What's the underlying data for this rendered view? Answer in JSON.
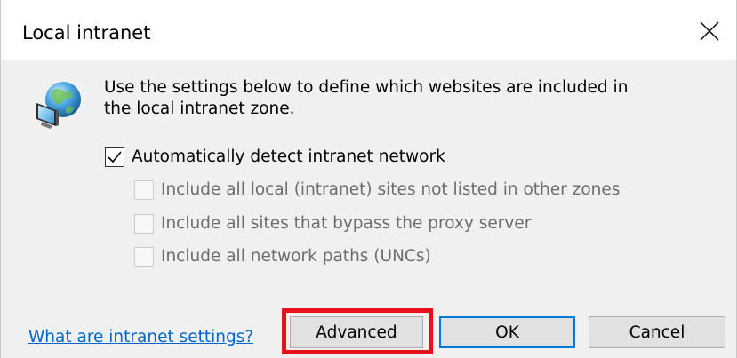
{
  "window": {
    "title": "Local intranet",
    "close_icon": "close-icon"
  },
  "intro": {
    "icon": "globe-monitor-icon",
    "line1": "Use the settings below to define which websites are included in",
    "line2": "the local intranet zone."
  },
  "options": {
    "auto_detect": {
      "label": "Automatically detect intranet network",
      "checked": true,
      "enabled": true
    },
    "include_local_sites": {
      "label": "Include all local (intranet) sites not listed in other zones",
      "checked": false,
      "enabled": false
    },
    "include_bypass_proxy": {
      "label": "Include all sites that bypass the proxy server",
      "checked": false,
      "enabled": false
    },
    "include_network_paths": {
      "label": "Include all network paths (UNCs)",
      "checked": false,
      "enabled": false
    }
  },
  "footer": {
    "help_link": "What are intranet settings?",
    "advanced_label": "Advanced",
    "ok_label": "OK",
    "cancel_label": "Cancel"
  },
  "colors": {
    "dialog_bg": "#f0f0f0",
    "link": "#0066cc",
    "default_button_border": "#0078d7",
    "highlight": "#e8101c"
  }
}
